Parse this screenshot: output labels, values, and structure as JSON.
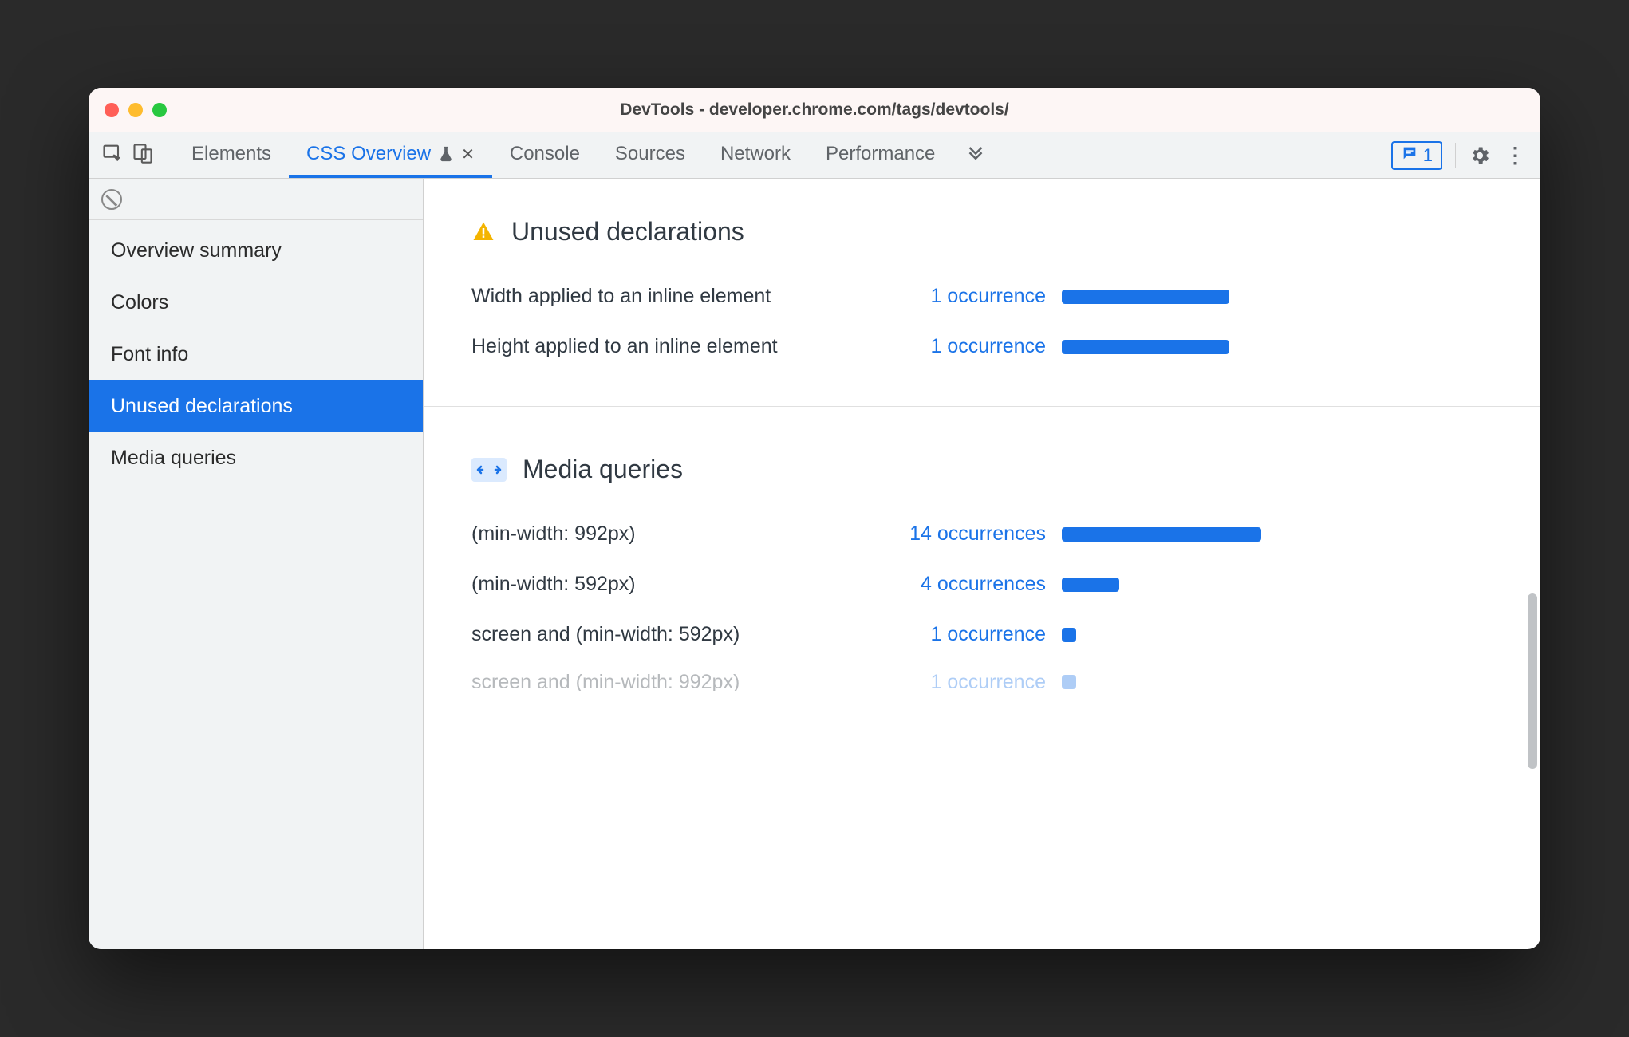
{
  "window": {
    "title": "DevTools - developer.chrome.com/tags/devtools/"
  },
  "tabs": {
    "items": [
      {
        "label": "Elements"
      },
      {
        "label": "CSS Overview"
      },
      {
        "label": "Console"
      },
      {
        "label": "Sources"
      },
      {
        "label": "Network"
      },
      {
        "label": "Performance"
      }
    ],
    "active_index": 1,
    "badge_count": "1"
  },
  "sidebar": {
    "items": [
      {
        "label": "Overview summary"
      },
      {
        "label": "Colors"
      },
      {
        "label": "Font info"
      },
      {
        "label": "Unused declarations"
      },
      {
        "label": "Media queries"
      }
    ],
    "selected_index": 3
  },
  "sections": {
    "unused": {
      "title": "Unused declarations",
      "rows": [
        {
          "label": "Width applied to an inline element",
          "occ": "1 occurrence",
          "bar": 210
        },
        {
          "label": "Height applied to an inline element",
          "occ": "1 occurrence",
          "bar": 210
        }
      ]
    },
    "media": {
      "title": "Media queries",
      "rows": [
        {
          "label": "(min-width: 992px)",
          "occ": "14 occurrences",
          "bar": 250
        },
        {
          "label": "(min-width: 592px)",
          "occ": "4 occurrences",
          "bar": 72
        },
        {
          "label": "screen and (min-width: 592px)",
          "occ": "1 occurrence",
          "bar": 18
        },
        {
          "label": "screen and (min-width: 992px)",
          "occ": "1 occurrence",
          "bar": 18
        }
      ]
    }
  }
}
